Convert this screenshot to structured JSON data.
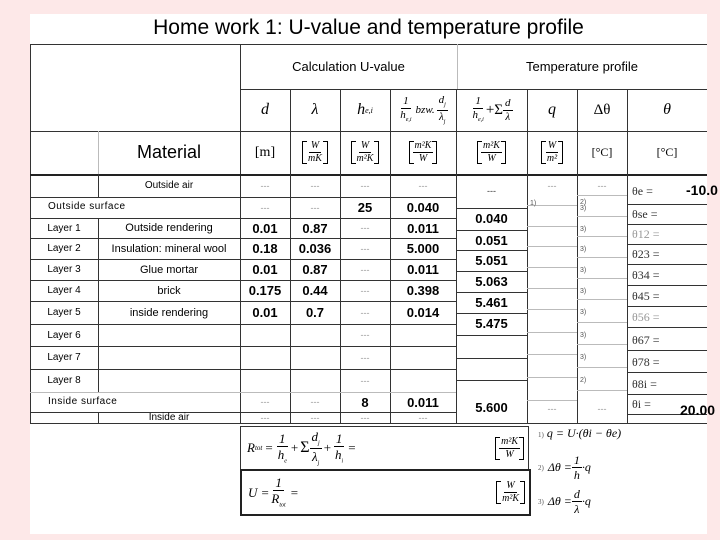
{
  "title": "Home work 1: U-value and temperature profile",
  "sections": {
    "calculation": "Calculation U-value",
    "temperature": "Temperature profile",
    "material": "Material"
  },
  "columns": {
    "d": "d",
    "lambda": "λ",
    "h": "h",
    "h_sub": "e,i",
    "r_one": "1",
    "r_h": "h",
    "r_h_sub": "e,i",
    "r_bzw": "bzw.",
    "r_d": "d",
    "r_d_sub": "j",
    "r_lambda": "λ",
    "r_lambda_sub": "j",
    "sum_one": "1",
    "sum_h": "h",
    "sum_h_sub": "e,i",
    "sum_plus": "+Σ",
    "sum_j": "j",
    "sum_d": "d",
    "sum_lambda": "λ",
    "q": "q",
    "dtheta": "Δθ",
    "theta": "θ"
  },
  "units": {
    "d": "[m]",
    "lambda_n": "W",
    "lambda_d": "mK",
    "h_n": "W",
    "h_d": "m²K",
    "r_n": "m²K",
    "r_d": "W",
    "sum_n": "m²K",
    "sum_d": "W",
    "q_n": "W",
    "q_d": "m²",
    "dtheta": "[°C]",
    "theta": "[°C]"
  },
  "rows": [
    {
      "layer": "",
      "material": "Outside air",
      "d": "---",
      "lambda": "---",
      "h": "---",
      "r": "---",
      "cum": "---",
      "q": "---",
      "dtheta": "---",
      "qnote": "1)",
      "dnote": "2)",
      "theta_label": "θe =",
      "theta_value": "-10.0"
    },
    {
      "layer": "Outside surface",
      "material": "",
      "d": "---",
      "lambda": "---",
      "h": "25",
      "r": "0.040",
      "cum": "0.040",
      "dnote": "3)",
      "theta_label": "θse ="
    },
    {
      "layer": "Layer 1",
      "material": "Outside rendering",
      "d": "0.01",
      "lambda": "0.87",
      "h": "---",
      "r": "0.011",
      "cum": "0.051",
      "dnote": "3)",
      "theta_label": "θ12 ="
    },
    {
      "layer": "Layer 2",
      "material": "Insulation: mineral wool",
      "d": "0.18",
      "lambda": "0.036",
      "h": "---",
      "r": "5.000",
      "cum": "5.051",
      "dnote": "3)",
      "theta_label": "θ23 ="
    },
    {
      "layer": "Layer 3",
      "material": "Glue mortar",
      "d": "0.01",
      "lambda": "0.87",
      "h": "---",
      "r": "0.011",
      "cum": "5.063",
      "dnote": "3)",
      "theta_label": "θ34 ="
    },
    {
      "layer": "Layer 4",
      "material": "brick",
      "d": "0.175",
      "lambda": "0.44",
      "h": "---",
      "r": "0.398",
      "cum": "5.461",
      "dnote": "3)",
      "theta_label": "θ45 ="
    },
    {
      "layer": "Layer 5",
      "material": "inside rendering",
      "d": "0.01",
      "lambda": "0.7",
      "h": "---",
      "r": "0.014",
      "cum": "5.475",
      "dnote": "3)",
      "theta_label": "θ56 ="
    },
    {
      "layer": "Layer 6",
      "material": "",
      "d": "",
      "lambda": "",
      "h": "---",
      "r": "",
      "cum": "",
      "dnote": "3)",
      "theta_label": "θ67 ="
    },
    {
      "layer": "Layer 7",
      "material": "",
      "d": "",
      "lambda": "",
      "h": "---",
      "r": "",
      "cum": "",
      "dnote": "3)",
      "theta_label": "θ78 ="
    },
    {
      "layer": "Layer 8",
      "material": "",
      "d": "",
      "lambda": "",
      "h": "---",
      "r": "",
      "cum": "",
      "dnote": "2)",
      "theta_label": "θ8i ="
    },
    {
      "layer": "Inside surface",
      "material": "",
      "d": "---",
      "lambda": "---",
      "h": "8",
      "r": "0.011",
      "cum": "5.600",
      "q": "---",
      "dtheta": "---",
      "theta_label": "θi =",
      "theta_value": "20.00"
    },
    {
      "layer": "",
      "material": "Inside air",
      "d": "---",
      "lambda": "---",
      "h": "---",
      "r": "---"
    }
  ],
  "formulas": {
    "rtot_lhs": "R",
    "rtot_sub": "tot",
    "rtot_unit_n": "m²K",
    "rtot_unit_d": "W",
    "u_lhs": "U = ",
    "u_num": "1",
    "u_den": "R",
    "u_den_sub": "tot",
    "u_unit_n": "W",
    "u_unit_d": "m²K",
    "note1_label": "1)",
    "note1": "q = U·(θi − θe)",
    "note2_label": "2)",
    "note2_lhs": "Δθ = ",
    "note2_n": "1",
    "note2_d": "h",
    "note2_rhs": "·q",
    "note3_label": "3)",
    "note3_lhs": "Δθ = ",
    "note3_n": "d",
    "note3_d": "λ",
    "note3_rhs": "·q"
  }
}
